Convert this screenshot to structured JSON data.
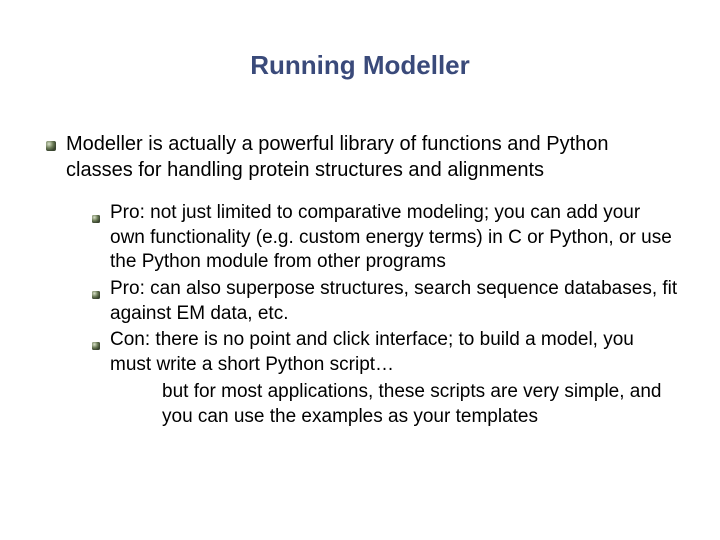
{
  "title": "Running Modeller",
  "main_point": "Modeller is actually a powerful library of functions and Python classes for handling protein structures and alignments",
  "sub_points": [
    "Pro: not just limited to comparative modeling; you can add your own functionality (e.g. custom energy terms) in C or Python, or use the Python module from other programs",
    "Pro: can also superpose structures, search sequence databases, fit against EM data, etc.",
    "Con: there is no point and click interface; to build a model, you must write a short Python script…"
  ],
  "continuation": "but for most applications, these scripts are very simple, and you can use the examples as your templates"
}
